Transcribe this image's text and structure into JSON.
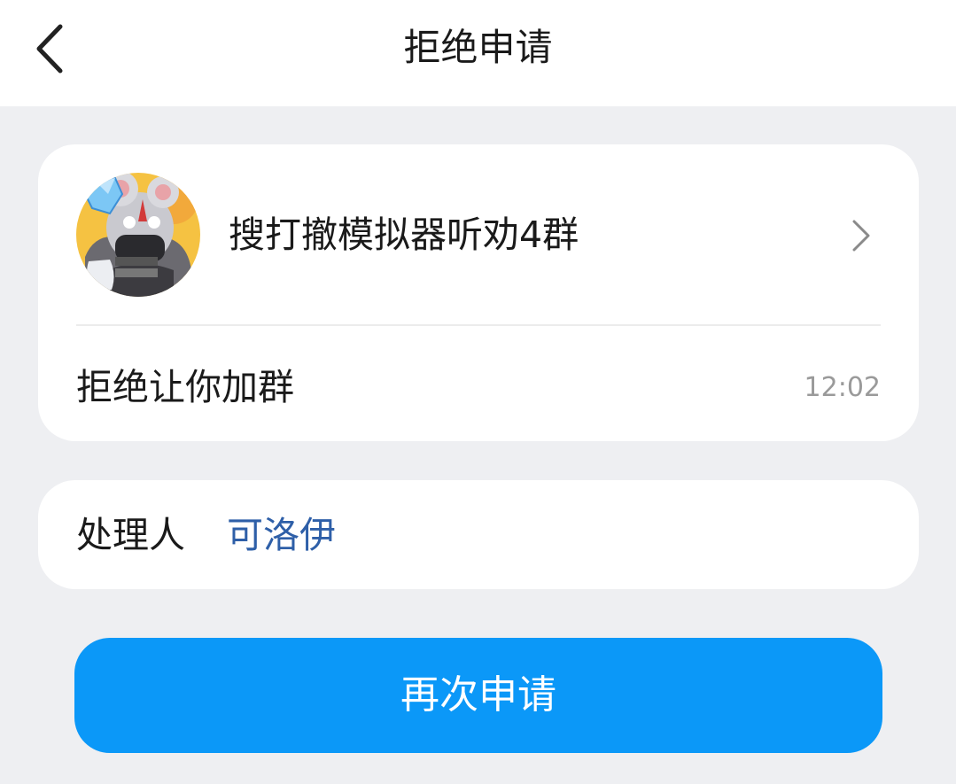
{
  "header": {
    "title": "拒绝申请",
    "back_icon": "chevron-left-icon"
  },
  "group_card": {
    "group_name": "搜打撤模拟器听劝4群",
    "avatar_icon": "group-avatar",
    "chevron_icon": "chevron-right-icon",
    "reason": "拒绝让你加群",
    "time": "12:02"
  },
  "handler_card": {
    "label": "处理人",
    "name": "可洛伊",
    "name_color": "#2e5fa8"
  },
  "actions": {
    "reapply_label": "再次申请",
    "button_color": "#0b98f8"
  }
}
